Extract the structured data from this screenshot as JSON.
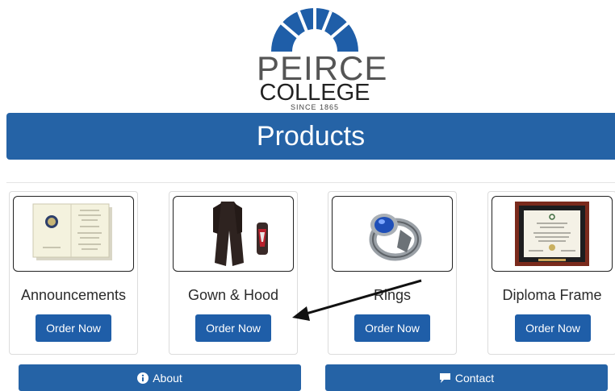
{
  "logo": {
    "line1": "PEIRCE",
    "line2": "COLLEGE",
    "line3": "SINCE 1865"
  },
  "banner": {
    "title": "Products"
  },
  "products": [
    {
      "label": "Announcements",
      "button": "Order Now",
      "image_icon": "announcement-card"
    },
    {
      "label": "Gown & Hood",
      "button": "Order Now",
      "image_icon": "gown-and-hood"
    },
    {
      "label": "Rings",
      "button": "Order Now",
      "image_icon": "class-ring"
    },
    {
      "label": "Diploma Frame",
      "button": "Order Now",
      "image_icon": "diploma-frame"
    }
  ],
  "footer": {
    "about": {
      "label": "About",
      "icon": "info-icon"
    },
    "contact": {
      "label": "Contact",
      "icon": "chat-bubble-icon"
    }
  },
  "colors": {
    "brand_blue": "#2563a6",
    "button_blue": "#1f5ea8"
  }
}
